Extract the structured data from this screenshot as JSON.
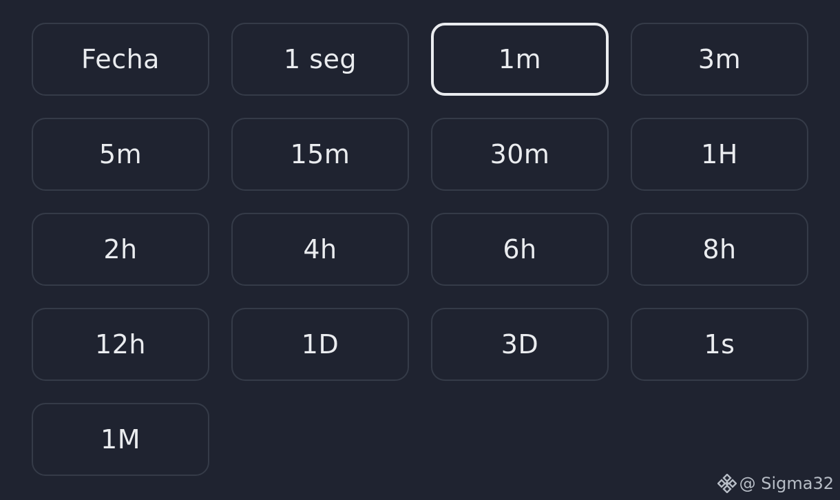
{
  "timeframes": [
    {
      "label": "Fecha",
      "selected": false
    },
    {
      "label": "1 seg",
      "selected": false
    },
    {
      "label": "1m",
      "selected": true
    },
    {
      "label": "3m",
      "selected": false
    },
    {
      "label": "5m",
      "selected": false
    },
    {
      "label": "15m",
      "selected": false
    },
    {
      "label": "30m",
      "selected": false
    },
    {
      "label": "1H",
      "selected": false
    },
    {
      "label": "2h",
      "selected": false
    },
    {
      "label": "4h",
      "selected": false
    },
    {
      "label": "6h",
      "selected": false
    },
    {
      "label": "8h",
      "selected": false
    },
    {
      "label": "12h",
      "selected": false
    },
    {
      "label": "1D",
      "selected": false
    },
    {
      "label": "3D",
      "selected": false
    },
    {
      "label": "1s",
      "selected": false
    },
    {
      "label": "1M",
      "selected": false
    }
  ],
  "watermark": {
    "icon": "binance-logo-icon",
    "text": "@ Sigma32"
  },
  "colors": {
    "background": "#1f2330",
    "button_border": "#353b48",
    "selected_border": "#eaecef",
    "text": "#eaecef"
  }
}
